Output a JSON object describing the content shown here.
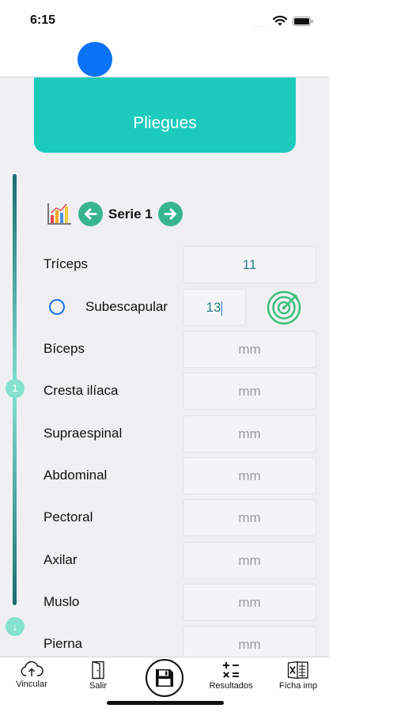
{
  "status_bar": {
    "time": "6:15",
    "signal": "...."
  },
  "banner": {
    "title": "Pliegues"
  },
  "progress": {
    "step": "1",
    "down_glyph": "↓"
  },
  "serie": {
    "label": "Serie 1"
  },
  "measurements": [
    {
      "label": "Tríceps",
      "value": "11",
      "placeholder": ""
    },
    {
      "label": "Subescapular",
      "value": "13",
      "placeholder": ""
    },
    {
      "label": "Bíceps",
      "value": "",
      "placeholder": "mm"
    },
    {
      "label": "Cresta ilíaca",
      "value": "",
      "placeholder": "mm"
    },
    {
      "label": "Supraespinal",
      "value": "",
      "placeholder": "mm"
    },
    {
      "label": "Abdominal",
      "value": "",
      "placeholder": "mm"
    },
    {
      "label": "Pectoral",
      "value": "",
      "placeholder": "mm"
    },
    {
      "label": "Axilar",
      "value": "",
      "placeholder": "mm"
    },
    {
      "label": "Muslo",
      "value": "",
      "placeholder": "mm"
    },
    {
      "label": "Pierna",
      "value": "",
      "placeholder": "mm"
    }
  ],
  "tabbar": {
    "vincular": "Vincular",
    "salir": "Salir",
    "resultados": "Resultados",
    "ficha": "Fícha imp"
  },
  "colors": {
    "accent": "#1dcbbd",
    "arrow": "#37b58e",
    "blue": "#0a72f5",
    "value_text": "#2a7f86"
  },
  "icons": [
    "wifi-icon",
    "battery-icon",
    "bar-chart-icon",
    "arrow-left-icon",
    "arrow-right-icon",
    "target-icon",
    "cloud-upload-icon",
    "door-exit-icon",
    "save-icon",
    "calculator-icon",
    "excel-icon"
  ]
}
